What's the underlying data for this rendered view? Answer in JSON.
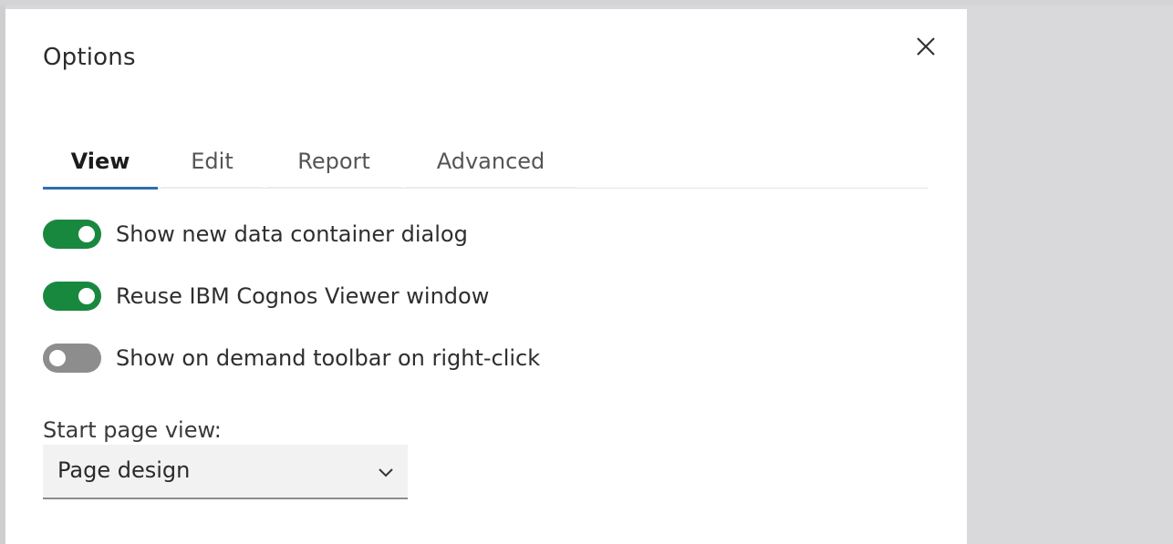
{
  "dialog": {
    "title": "Options",
    "close_icon": "close-icon"
  },
  "tabs": [
    {
      "label": "View",
      "active": true
    },
    {
      "label": "Edit",
      "active": false
    },
    {
      "label": "Report",
      "active": false
    },
    {
      "label": "Advanced",
      "active": false
    }
  ],
  "settings": {
    "toggles": [
      {
        "label": "Show new data container dialog",
        "on": true
      },
      {
        "label": "Reuse IBM Cognos Viewer window",
        "on": true
      },
      {
        "label": "Show on demand toolbar on right-click",
        "on": false
      }
    ],
    "start_page": {
      "label": "Start page view:",
      "value": "Page design",
      "chevron_icon": "chevron-down-icon"
    }
  },
  "colors": {
    "toggle_on": "#19883f",
    "toggle_off": "#8d8d8d",
    "tab_indicator": "#2f6db4"
  }
}
